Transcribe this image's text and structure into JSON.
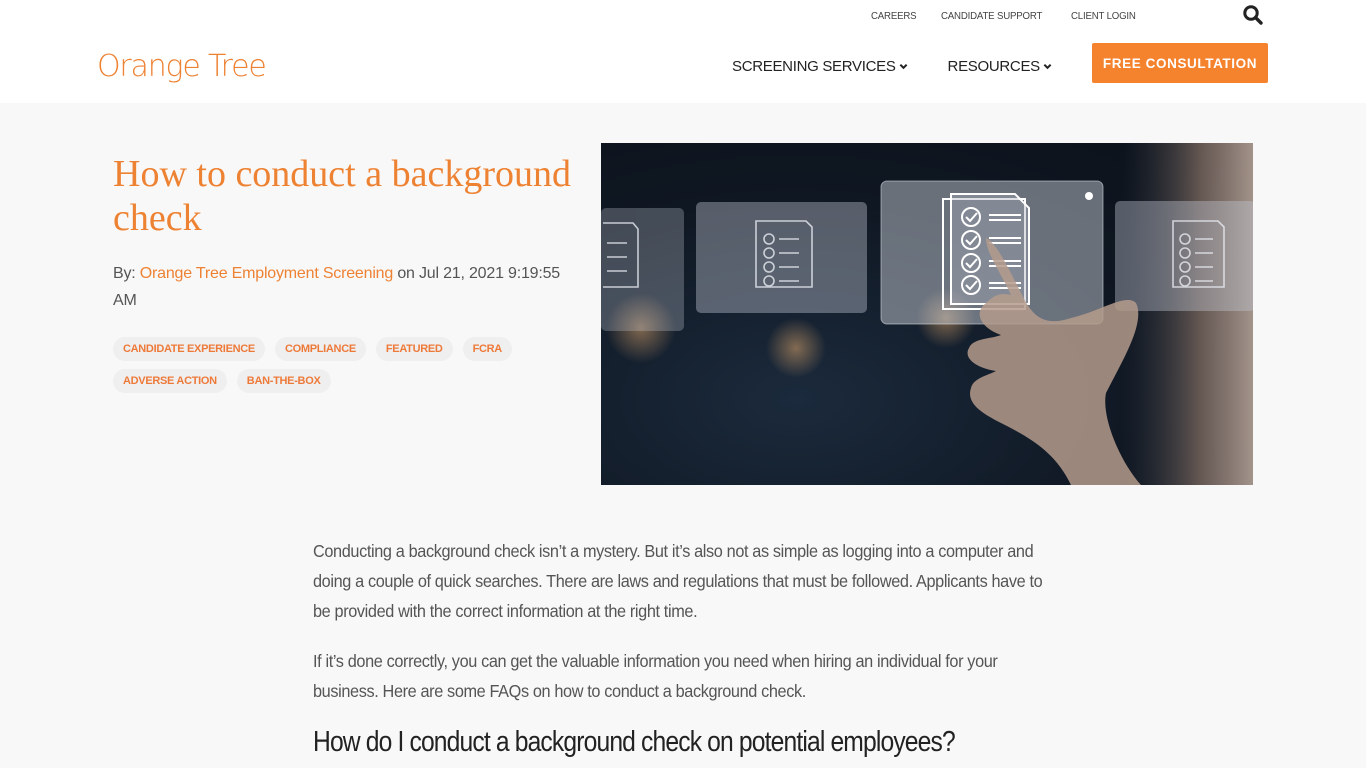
{
  "header": {
    "logo_text": "Orange Tree",
    "utility_links": [
      "CAREERS",
      "CANDIDATE SUPPORT",
      "CLIENT LOGIN"
    ],
    "search_icon": "search-icon",
    "nav": [
      {
        "label": "SCREENING SERVICES",
        "icon": "chevron-down-icon"
      },
      {
        "label": "RESOURCES",
        "icon": "chevron-down-icon"
      }
    ],
    "cta_label": "FREE CONSULTATION"
  },
  "article": {
    "title": "How to conduct a background check",
    "byline_prefix": "By:",
    "author": "Orange Tree Employment Screening",
    "date_prefix": "on",
    "date": "Jul 21, 2021 9:19:55 AM",
    "tags": [
      "CANDIDATE EXPERIENCE",
      "COMPLIANCE",
      "FEATURED",
      "FCRA",
      "ADVERSE ACTION",
      "BAN-THE-BOX"
    ],
    "hero_image_alt": "Hand touching a virtual checklist document on a digital screen",
    "paragraphs": [
      "Conducting a background check isn’t a mystery. But it’s also not as simple as logging into a computer and doing a couple of quick searches. There are laws and regulations that must be followed. Applicants have to be provided with the correct information at the right time.",
      "If it’s done correctly, you can get the valuable information you need when hiring an individual for your business. Here are some FAQs on how to conduct a background check."
    ],
    "subheading": "How do I conduct a background check on potential employees?"
  },
  "colors": {
    "brand_orange": "#ee8233",
    "cta_orange": "#f5822d",
    "page_background": "#f8f8f8",
    "header_background": "#ffffff",
    "tag_background": "#efefef"
  }
}
